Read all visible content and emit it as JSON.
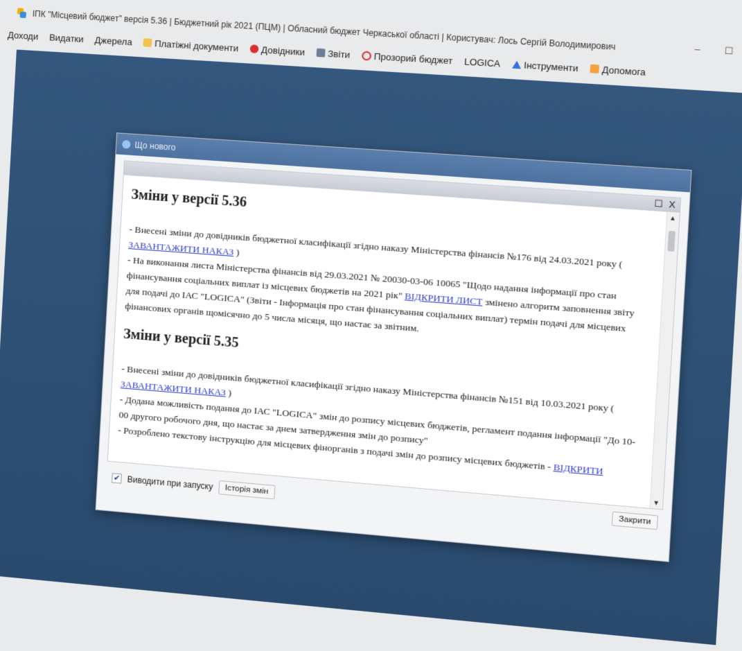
{
  "window": {
    "title": "ІПК \"Місцевий бюджет\" версія 5.36 | Бюджетний рік 2021 (ПЦМ) | Обласний бюджет Черкаської області | Користувач: Лось Сергій Володимирович",
    "minimize": "–",
    "maximize": "☐",
    "close": "X"
  },
  "menu": [
    {
      "label": "Доходи"
    },
    {
      "label": "Видатки"
    },
    {
      "label": "Джерела"
    },
    {
      "label": "Платіжні документи",
      "icon": "docs-icon"
    },
    {
      "label": "Довідники",
      "icon": "reference-icon"
    },
    {
      "label": "Звіти",
      "icon": "reports-icon"
    },
    {
      "label": "Прозорий бюджет",
      "icon": "prozorro-icon"
    },
    {
      "label": "LOGICA"
    },
    {
      "label": "Інструменти",
      "icon": "tools-icon"
    },
    {
      "label": "Допомога",
      "icon": "help-icon"
    }
  ],
  "dialog": {
    "title": "Що нового",
    "frame_maximize": "☐",
    "frame_close": "X",
    "sections": [
      {
        "heading": "Зміни у версії 5.36",
        "items": [
          {
            "text": "- Внесені зміни до довідників бюджетної класифікації згідно наказу Міністерства фінансів №176 від 24.03.2021 року (",
            "link": "ЗАВАНТАЖИТИ НАКАЗ",
            "after": ")"
          },
          {
            "text": "- На виконання листа Міністерства фінансів від 29.03.2021 № 20030-03-06 10065 \"Щодо надання інформації про стан фінансування соціальних виплат із місцевих бюджетів на 2021 рік\"",
            "link": "ВІДКРИТИ ЛИСТ",
            "after": "змінено алгоритм заповнення звіту для подачі до ІАС \"LOGICA\" (Звіти - Інформація про стан фінансування соціальних виплат) термін подачі для місцевих фінансових органів щомісячно до 5 числа місяця, що настає за звітним."
          }
        ]
      },
      {
        "heading": "Зміни у версії 5.35",
        "items": [
          {
            "text": "- Внесені зміни до довідників бюджетної класифікації згідно наказу Міністерства фінансів №151 від 10.03.2021 року (",
            "link": "ЗАВАНТАЖИТИ НАКАЗ",
            "after": ")"
          },
          {
            "text": "- Додана можливість подання до ІАС \"LOGICA\" змін до розпису місцевих бюджетів, регламент подання інформації \"До 10-00 другого робочого дня, що настає за днем затвердження змін до розпису\"",
            "link": "",
            "after": ""
          },
          {
            "text": "- Розроблено текстову інструкцію для місцевих фінорганів з подачі змін до розпису місцевих бюджетів -",
            "link": "ВІДКРИТИ",
            "after": ""
          }
        ]
      }
    ],
    "footer": {
      "checkbox_label": "Виводити при запуску",
      "checkbox_checked": "✔",
      "history_button": "Історія змін",
      "close_button": "Закрити"
    }
  }
}
